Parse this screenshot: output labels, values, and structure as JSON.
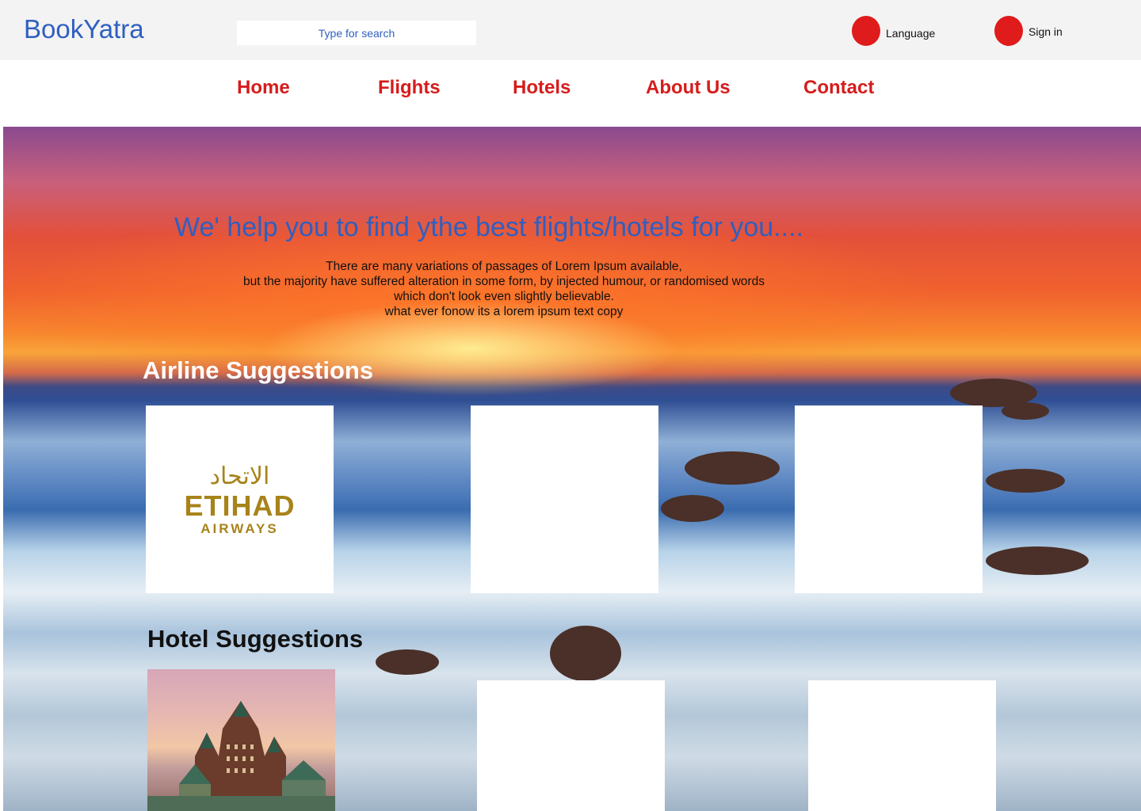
{
  "header": {
    "logo": "BookYatra",
    "search_placeholder": "Type for search",
    "language_label": "Language",
    "signin_label": "Sign in"
  },
  "nav": {
    "items": [
      "Home",
      "Flights",
      "Hotels",
      "About Us",
      "Contact"
    ]
  },
  "hero": {
    "title": "We' help you to find ythe best flights/hotels for you....",
    "description": [
      "There are many variations of passages of Lorem Ipsum available,",
      "but the majority have suffered alteration in some form, by injected humour, or randomised words",
      "which don't look even slightly believable.",
      "what ever fonow its a lorem ipsum text copy"
    ]
  },
  "airline_section": {
    "title": "Airline Suggestions",
    "logo_arabic": "الاتحاد",
    "logo_main": "ETIHAD",
    "logo_sub": "AIRWAYS"
  },
  "hotel_section": {
    "title": "Hotel Suggestions"
  },
  "colors": {
    "brand_blue": "#2f5fc1",
    "nav_red": "#d61c1c",
    "icon_red": "#e01b1b",
    "etihad_gold": "#a8831a"
  }
}
